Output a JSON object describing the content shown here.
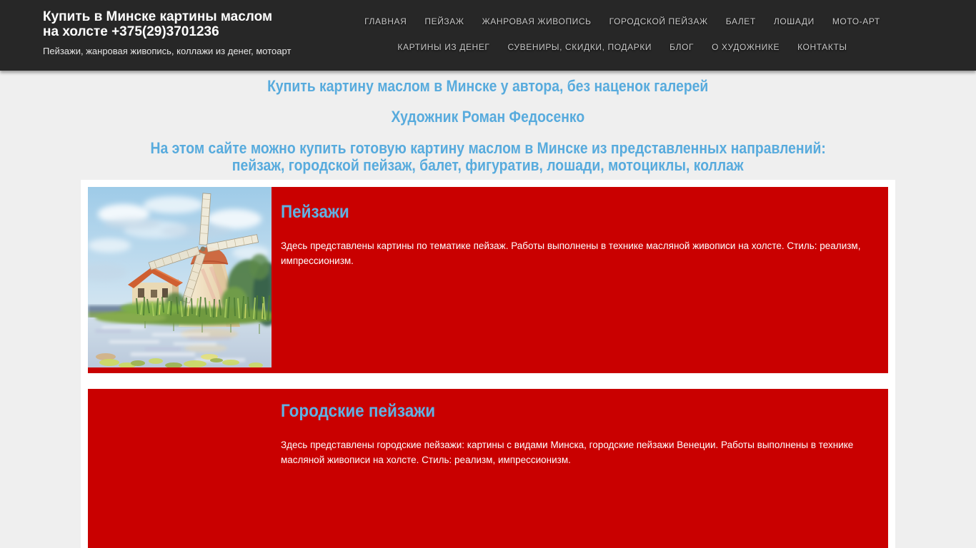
{
  "header": {
    "title_line1": "Купить в Минске картины маслом",
    "title_line2": "на холсте +375(29)3701236",
    "tagline": "Пейзажи, жанровая живопись, коллажи из денег, мотоарт",
    "nav_items": [
      "ГЛАВНАЯ",
      "ПЕЙЗАЖ",
      "ЖАНРОВАЯ ЖИВОПИСЬ",
      "ГОРОДСКОЙ ПЕЙЗАЖ",
      "БАЛЕТ",
      "ЛОШАДИ",
      "МОТО-АРТ",
      "КАРТИНЫ ИЗ ДЕНЕГ",
      "СУВЕНИРЫ, СКИДКИ, ПОДАРКИ",
      "БЛОГ",
      "О ХУДОЖНИКЕ",
      "КОНТАКТЫ"
    ]
  },
  "intro": {
    "heading1": "Купить картину маслом в Минске у автора, без наценок галерей",
    "heading2": "Художник Роман Федосенко",
    "heading3_line1": "На этом сайте можно купить готовую картину маслом в Минске из представленных направлений:",
    "heading3_line2": "пейзаж, городской пейзаж, балет, фигуратив, лошади, мотоциклы, коллаж"
  },
  "categories": [
    {
      "title": "Пейзажи",
      "description": "Здесь представлены картины по тематике пейзаж. Работы выполнены в технике масляной живописи на холсте. Стиль: реализм, импрессионизм.",
      "image": "windmill-landscape-oil-painting"
    },
    {
      "title": "Городские пейзажи",
      "description": "Здесь представлены городские пейзажи: картины с видами Минска, городские пейзажи Венеции. Работы выполнены в технике масляной живописи на холсте. Стиль: реализм, импрессионизм."
    }
  ],
  "colors": {
    "header_bg": "#272727",
    "page_bg": "#efefef",
    "card_red": "#c90000",
    "accent_blue": "#58abdd",
    "card_title_blue": "#60b1e3"
  }
}
